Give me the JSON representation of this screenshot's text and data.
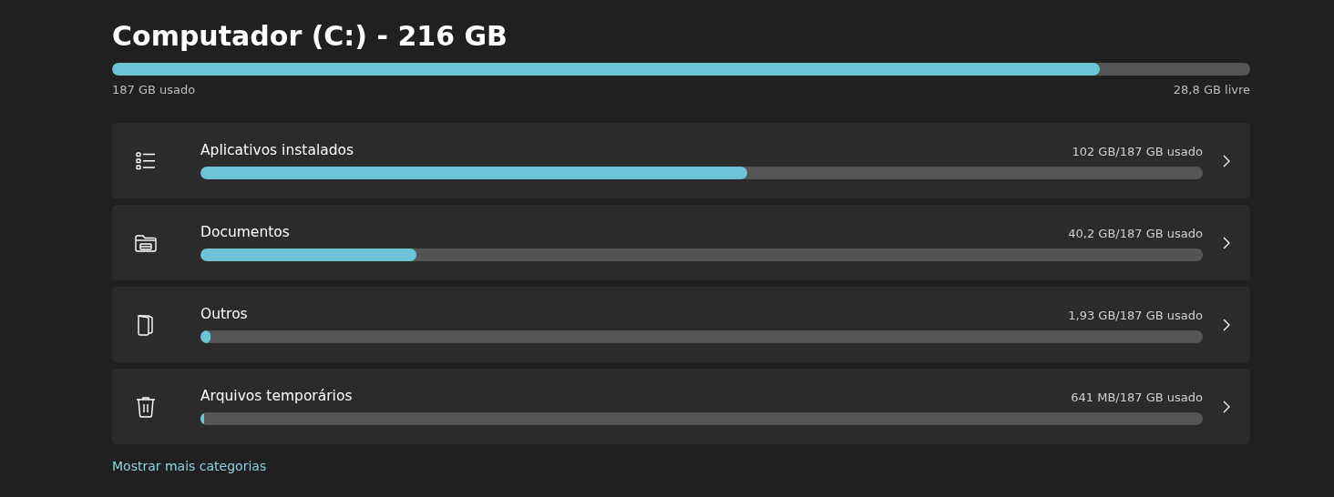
{
  "drive": {
    "title": "Computador (C:) - 216 GB",
    "level": 0.868,
    "used": "187 GB usado",
    "free": "28,8 GB livre"
  },
  "categories": [
    {
      "name": "Aplicativos instalados",
      "usage": "102 GB/187 GB usado",
      "level": 0.545
    },
    {
      "name": "Documentos",
      "usage": "40,2 GB/187 GB usado",
      "level": 0.215
    },
    {
      "name": "Outros",
      "usage": "1,93 GB/187 GB usado",
      "level": 0.0103
    },
    {
      "name": "Arquivos temporários",
      "usage": "641 MB/187 GB usado",
      "level": 0.0034
    }
  ],
  "more_link": "Mostrar mais categorias"
}
